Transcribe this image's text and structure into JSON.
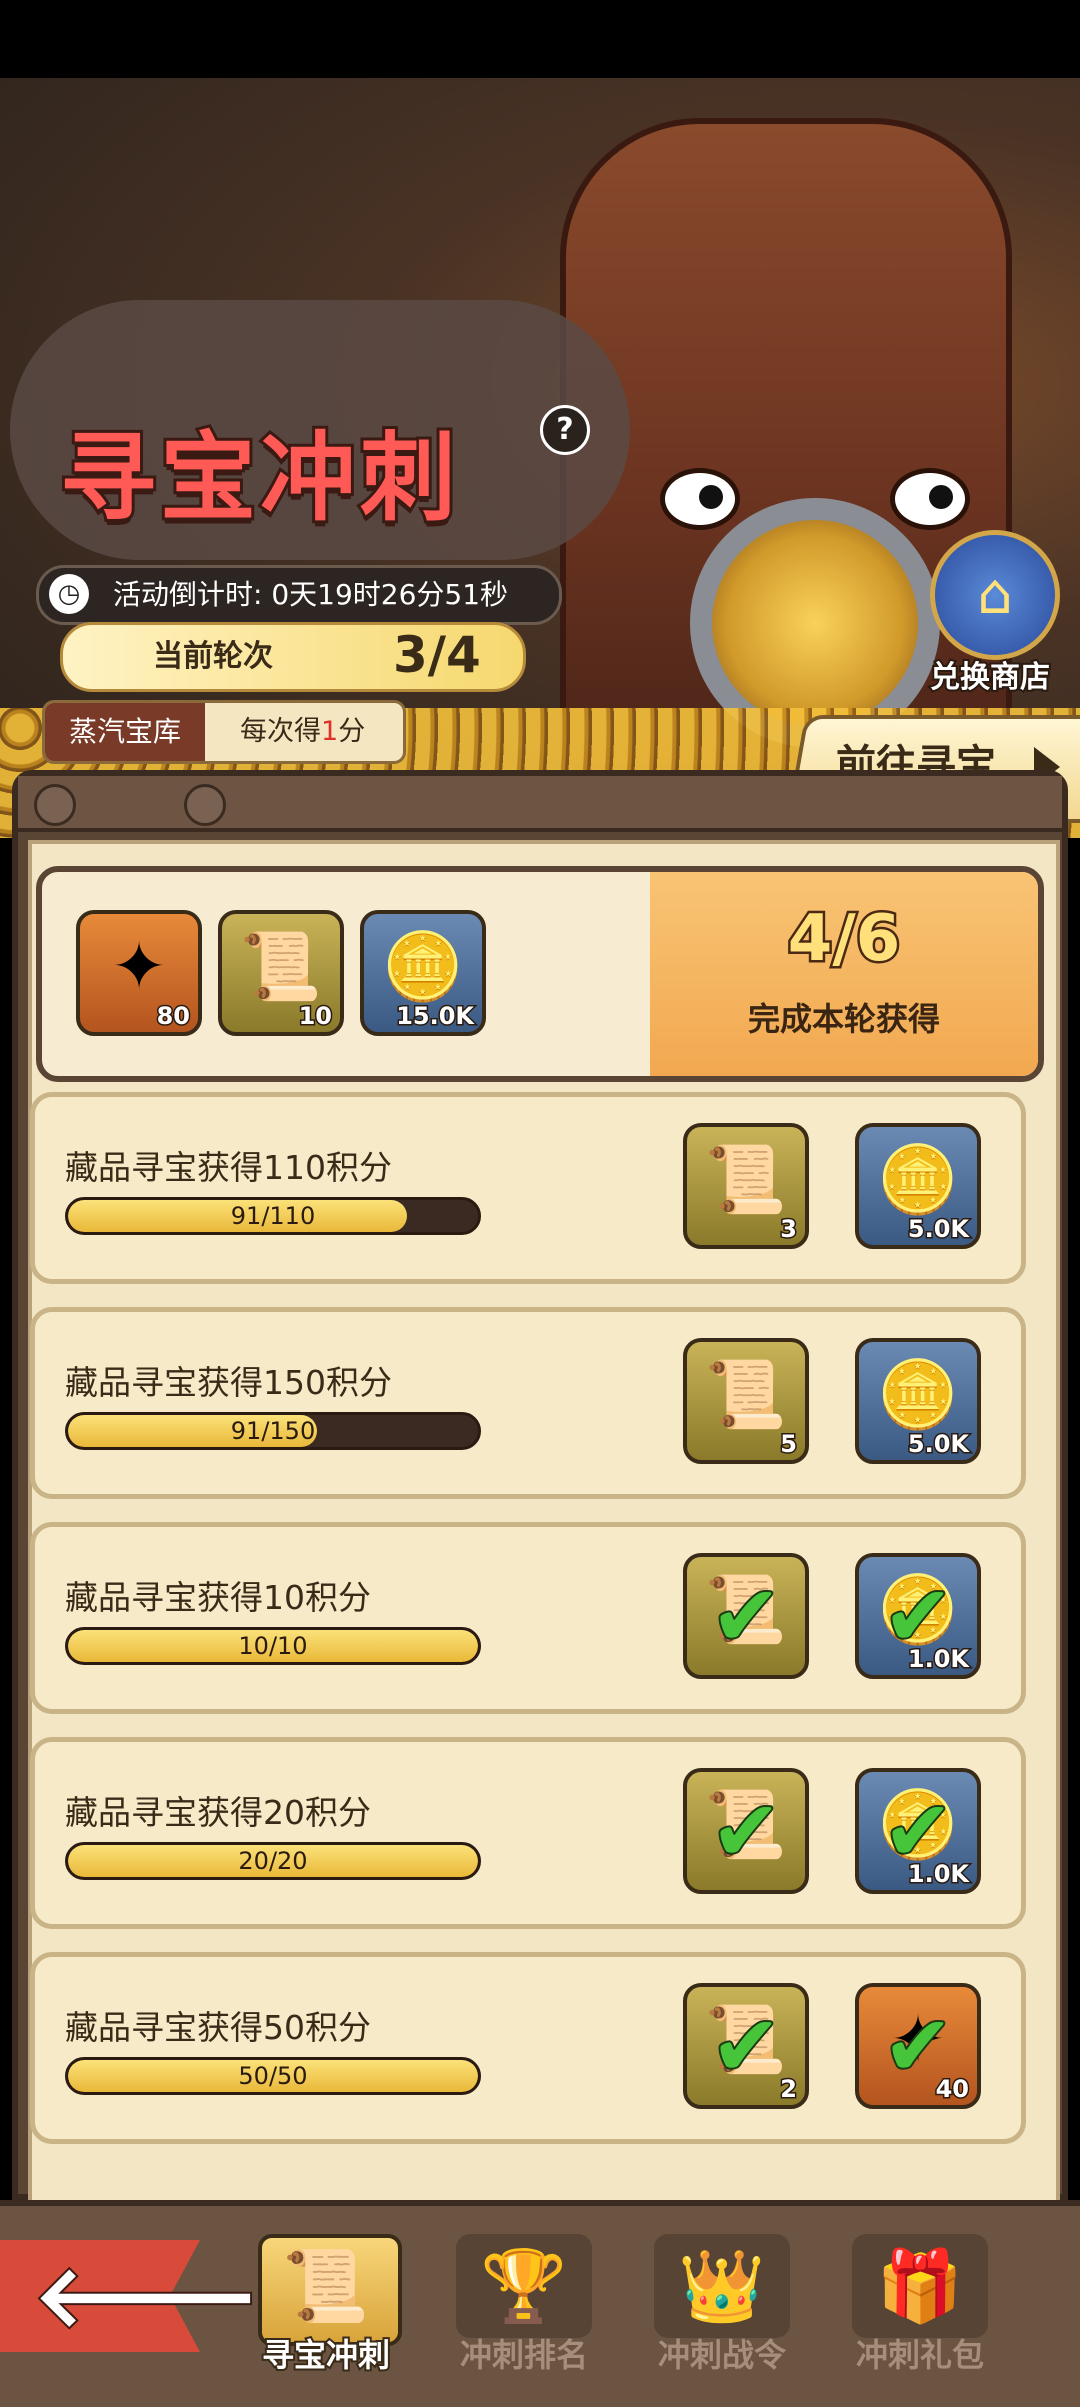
{
  "event": {
    "title": "寻宝冲刺",
    "help_icon": "?",
    "countdown_label": "活动倒计时:",
    "countdown_value": "0天19时26分51秒",
    "round_label": "当前轮次",
    "round_value": "3/4",
    "vault_name": "蒸汽宝库",
    "vault_rate_prefix": "每次得",
    "vault_rate_value": "1",
    "vault_rate_suffix": "分",
    "shop_label": "兑换商店",
    "go_button_label": "前往寻宝"
  },
  "summary": {
    "rewards": [
      {
        "icon": "star-shard-icon",
        "glyph": "✦",
        "qty": "80",
        "style": "orange"
      },
      {
        "icon": "scroll-icon",
        "glyph": "📜",
        "qty": "10",
        "style": "olive"
      },
      {
        "icon": "gold-coin-icon",
        "glyph": "🪙",
        "qty": "15.0K",
        "style": "blue"
      }
    ],
    "count": "4/6",
    "caption": "完成本轮获得"
  },
  "tasks": [
    {
      "title": "藏品寻宝获得110积分",
      "progress_text": "91/110",
      "progress": 0.827,
      "rewards": [
        {
          "icon": "scroll-icon",
          "glyph": "📜",
          "qty": "3",
          "style": "olive",
          "claimed": false
        },
        {
          "icon": "gold-coin-icon",
          "glyph": "🪙",
          "qty": "5.0K",
          "style": "blue",
          "claimed": false
        }
      ]
    },
    {
      "title": "藏品寻宝获得150积分",
      "progress_text": "91/150",
      "progress": 0.607,
      "rewards": [
        {
          "icon": "scroll-icon",
          "glyph": "📜",
          "qty": "5",
          "style": "olive",
          "claimed": false
        },
        {
          "icon": "gold-coin-icon",
          "glyph": "🪙",
          "qty": "5.0K",
          "style": "blue",
          "claimed": false
        }
      ]
    },
    {
      "title": "藏品寻宝获得10积分",
      "progress_text": "10/10",
      "progress": 1.0,
      "rewards": [
        {
          "icon": "scroll-icon",
          "glyph": "📜",
          "qty": "",
          "style": "olive",
          "claimed": true
        },
        {
          "icon": "gold-coin-icon",
          "glyph": "🪙",
          "qty": "1.0K",
          "style": "blue",
          "claimed": true
        }
      ]
    },
    {
      "title": "藏品寻宝获得20积分",
      "progress_text": "20/20",
      "progress": 1.0,
      "rewards": [
        {
          "icon": "scroll-icon",
          "glyph": "📜",
          "qty": "",
          "style": "olive",
          "claimed": true
        },
        {
          "icon": "gold-coin-icon",
          "glyph": "🪙",
          "qty": "1.0K",
          "style": "blue",
          "claimed": true
        }
      ]
    },
    {
      "title": "藏品寻宝获得50积分",
      "progress_text": "50/50",
      "progress": 1.0,
      "rewards": [
        {
          "icon": "scroll-icon",
          "glyph": "📜",
          "qty": "2",
          "style": "olive",
          "claimed": true
        },
        {
          "icon": "star-shard-icon",
          "glyph": "✦",
          "qty": "40",
          "style": "orange",
          "claimed": true
        }
      ]
    }
  ],
  "nav": {
    "back_icon": "back-arrow-icon",
    "tabs": [
      {
        "label": "寻宝冲刺",
        "icon": "scroll-icon",
        "glyph": "📜",
        "active": true
      },
      {
        "label": "冲刺排名",
        "icon": "trophy-icon",
        "glyph": "🏆",
        "active": false
      },
      {
        "label": "冲刺战令",
        "icon": "crown-icon",
        "glyph": "👑",
        "active": false
      },
      {
        "label": "冲刺礼包",
        "icon": "gift-chest-icon",
        "glyph": "🎁",
        "active": false
      }
    ]
  },
  "colors": {
    "accent_red": "#ff5a55",
    "check_green": "#46c43a",
    "bar_yellow": "#e9b838"
  }
}
